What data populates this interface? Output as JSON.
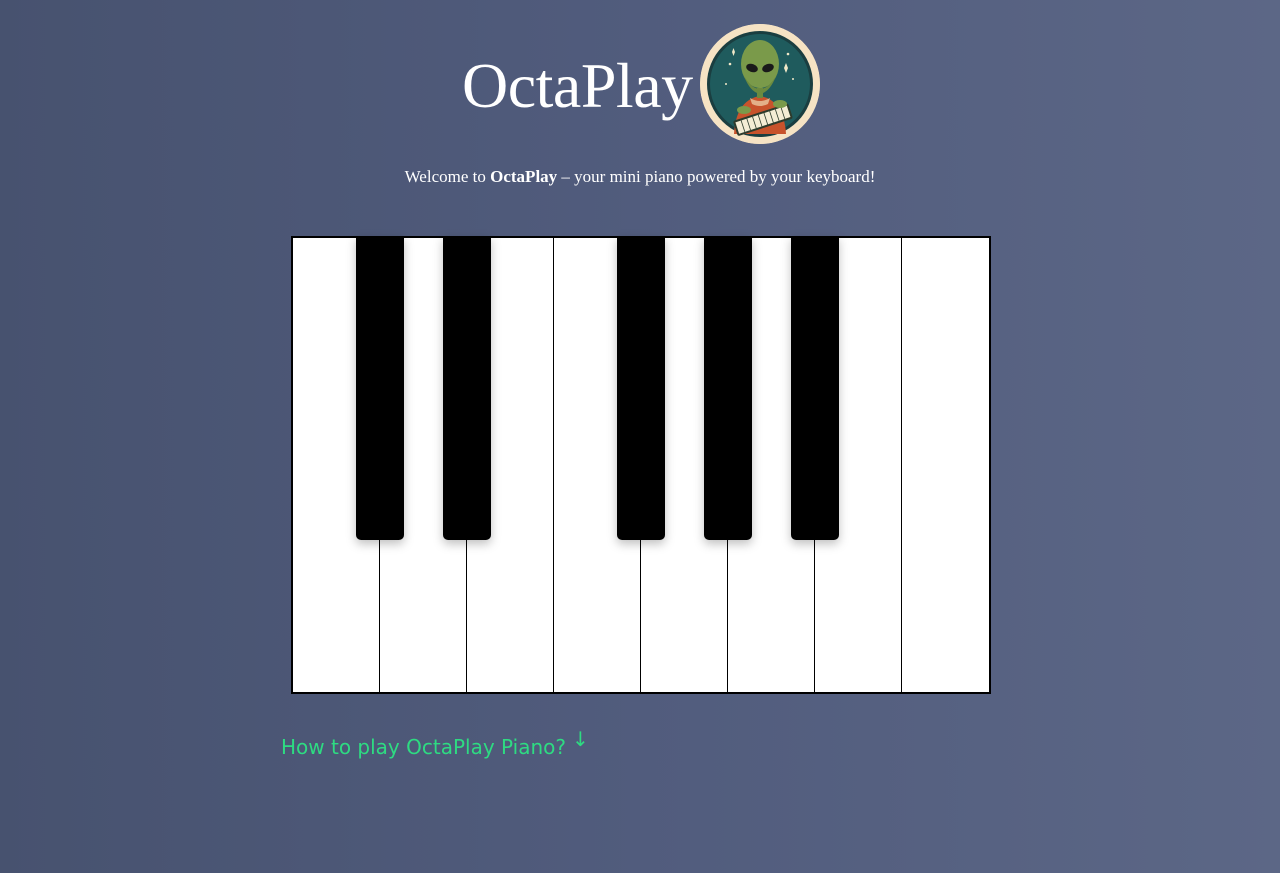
{
  "header": {
    "title": "OctaPlay",
    "logo_icon": "alien-pianist-logo"
  },
  "welcome": {
    "prefix": "Welcome to ",
    "brand": "OctaPlay",
    "suffix": " – your mini piano powered by your keyboard!"
  },
  "piano": {
    "white_keys": 8,
    "black_keys": 5
  },
  "help_link": {
    "label": "How to play OctaPlay Piano?",
    "arrow": "↓"
  },
  "colors": {
    "background_start": "#47526f",
    "background_end": "#5c6786",
    "link": "#2edb82",
    "logo_bg": "#f6e3c4",
    "logo_inner": "#1e5a5c"
  }
}
